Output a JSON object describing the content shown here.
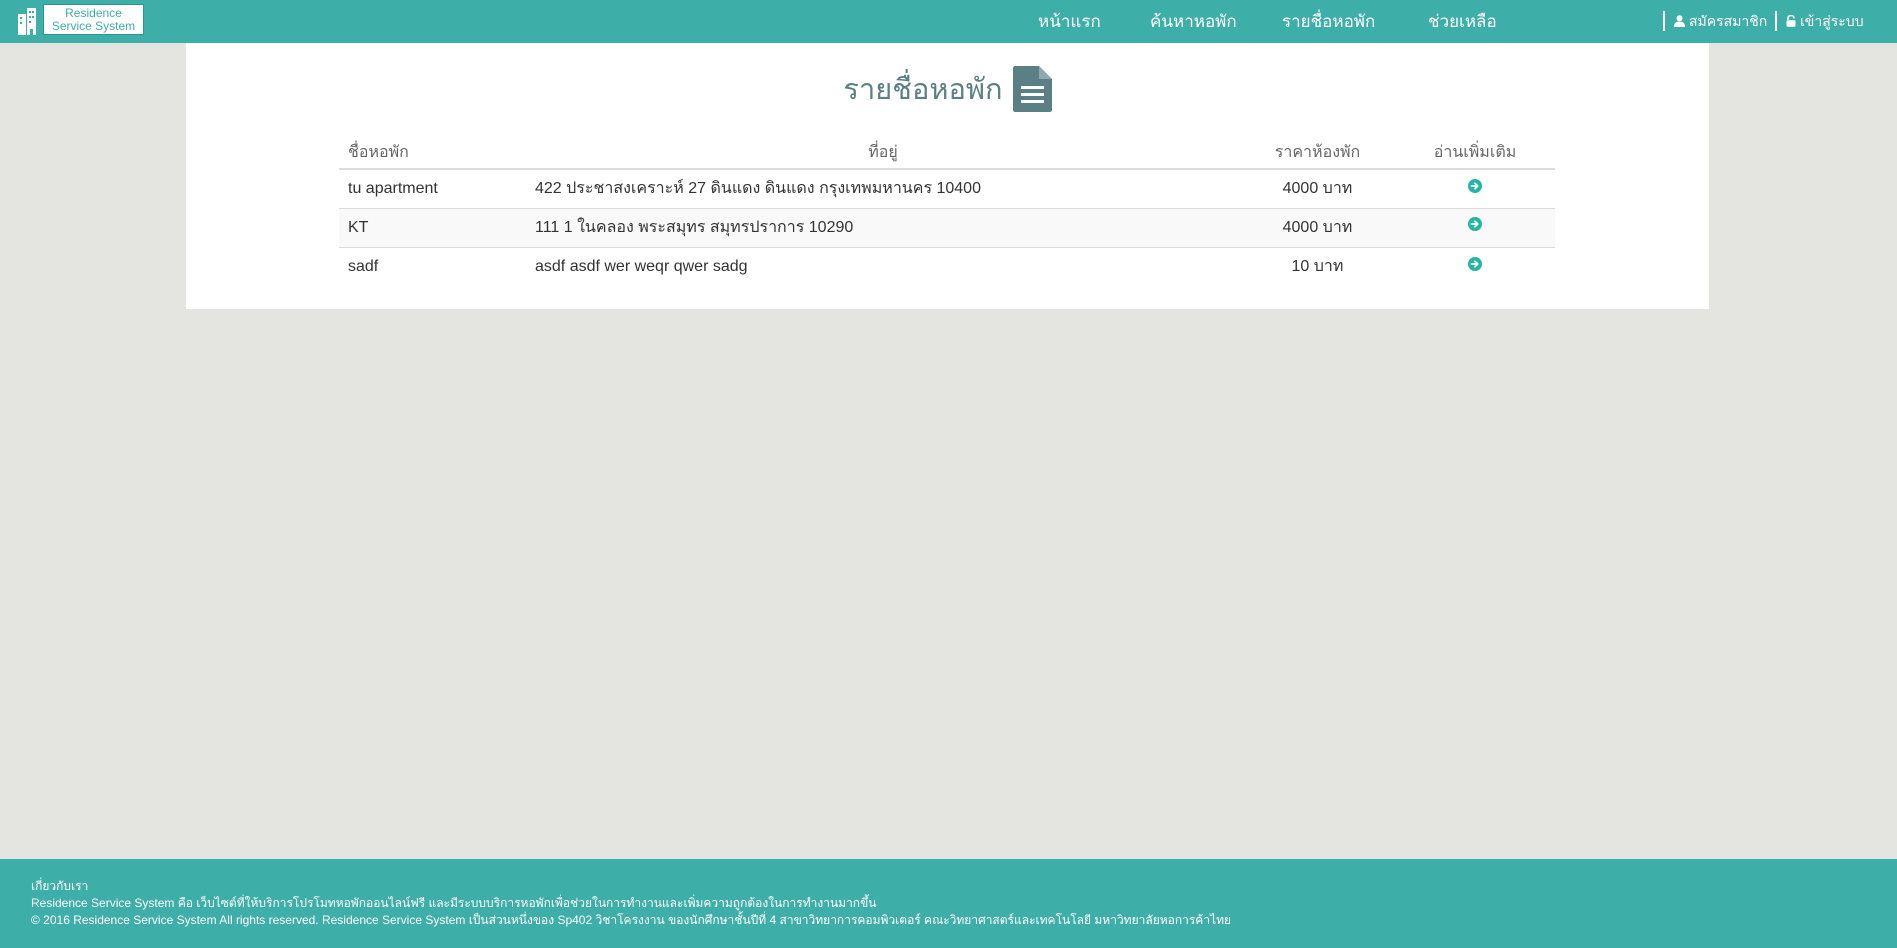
{
  "header": {
    "brand": {
      "line1": "Residence",
      "line2": "Service System"
    },
    "nav": [
      {
        "label": "หน้าแรก"
      },
      {
        "label": "ค้นหาหอพัก"
      },
      {
        "label": "รายชื่อหอพัก"
      },
      {
        "label": "ช่วยเหลือ"
      }
    ],
    "register_label": "สมัครสมาชิก",
    "login_label": "เข้าสู่ระบบ"
  },
  "main": {
    "title": "รายชื่อหอพัก",
    "columns": {
      "name": "ชื่อหอพัก",
      "address": "ที่อยู่",
      "price": "ราคาห้องพัก",
      "more": "อ่านเพิ่มเติม"
    },
    "rows": [
      {
        "name": "tu apartment",
        "address": "422 ประชาสงเคราะห์ 27 ดินแดง ดินแดง กรุงเทพมหานคร 10400",
        "price": "4000 บาท"
      },
      {
        "name": "KT",
        "address": "111 1 ในคลอง พระสมุทร สมุทรปราการ 10290",
        "price": "4000 บาท"
      },
      {
        "name": "sadf",
        "address": "asdf asdf wer weqr qwer sadg",
        "price": "10 บาท"
      }
    ]
  },
  "footer": {
    "about_heading": "เกี่ยวกับเรา",
    "about_text": "Residence Service System คือ เว็บไซต์ที่ให้บริการโปรโมทหอพักออนไลน์ฟรี และมีระบบบริการหอพักเพื่อช่วยในการทำงานและเพิ่มความถูกต้องในการทำงานมากขึ้น",
    "copyright": "© 2016 Residence Service System All rights reserved. Residence Service System เป็นส่วนหนึ่งของ Sp402 วิชาโครงงาน ของนักศึกษาชั้นปีที่ 4 สาขาวิทยาการคอมพิวเตอร์ คณะวิทยาศาสตร์และเทคโนโลยี มหาวิทยาลัยหอการค้าไทย"
  },
  "colors": {
    "primary": "#3eaea8",
    "title": "#5a7f85",
    "background": "#e4e5e0",
    "arrow": "#24b5a6"
  },
  "icons": {
    "brand": "building-icon",
    "title": "document-icon",
    "register": "user-icon",
    "login": "unlock-icon",
    "row_more": "arrow-circle-right-icon"
  }
}
